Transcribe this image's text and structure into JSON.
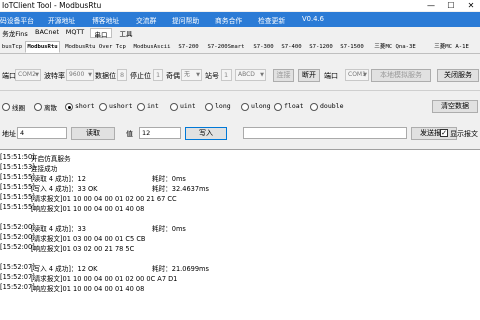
{
  "window": {
    "title": "IoTClient Tool - ModbusRtu",
    "minimize": "—",
    "maximize": "☐",
    "close": "✕"
  },
  "menu": [
    "码设备平台",
    "开源地址",
    "博客地址",
    "交流群",
    "提问帮助",
    "商务合作",
    "检查更新",
    "V0.4.6"
  ],
  "tabs_row1": [
    "务龙Fins",
    "BACnet",
    "MQTT",
    "串口",
    "工具"
  ],
  "tabs_row2": [
    "busTcp",
    "ModbusRtu",
    "ModbusRtu Over Tcp",
    "ModbusAscii",
    "S7-200",
    "S7-200Smart",
    "S7-300",
    "S7-400",
    "S7-1200",
    "S7-1500",
    "三菱MC Qna-3E",
    "三菱MC A-1E"
  ],
  "serial": {
    "port_label": "端口",
    "port_value": "COM2",
    "baud_label": "波特率",
    "baud_value": "9600",
    "databits_label": "数据位",
    "databits_value": "8",
    "stopbits_label": "停止位",
    "stopbits_value": "1",
    "parity_label": "奇偶",
    "parity_value": "无",
    "station_label": "站号",
    "station_value": "1",
    "abcd_value": "ABCD",
    "connect_btn": "连接",
    "disconnect_btn": "断开",
    "sim_port_label": "端口",
    "sim_port_value": "COM1",
    "start_sim_btn": "本地模拟服务",
    "stop_sim_btn": "关闭服务"
  },
  "types": [
    "线圈",
    "离散",
    "short",
    "ushort",
    "int",
    "uint",
    "long",
    "ulong",
    "float",
    "double"
  ],
  "selected_type": "short",
  "clear_btn": "清空数据",
  "rw": {
    "address_label": "地址",
    "address_value": "4",
    "read_btn": "读取",
    "value_label": "值",
    "value_value": "12",
    "write_btn": "写入",
    "raw_value": "",
    "send_btn": "发送报文",
    "show_msg_label": "显示报文",
    "show_msg_checked": "✓"
  },
  "log": [
    {
      "time": "[15:51:50]",
      "msg": "开启仿真服务"
    },
    {
      "time": "[15:51:53]",
      "msg": "连接成功"
    },
    {
      "time": "[15:51:55]",
      "msg": "[读取 4 成功]：12",
      "extra": "耗时：0ms"
    },
    {
      "time": "[15:51:55]",
      "msg": "[写入 4 成功]：33 OK",
      "extra": "耗时：32.4637ms"
    },
    {
      "time": "[15:51:55]",
      "msg": "[请求报文]01 10 00 04 00 01 02 00 21 67 CC"
    },
    {
      "time": "[15:51:55]",
      "msg": "[响应报文]01 10 00 04 00 01 40 08"
    },
    {
      "time": "",
      "msg": ""
    },
    {
      "time": "[15:52:00]",
      "msg": "[读取 4 成功]：33",
      "extra": "耗时：0ms"
    },
    {
      "time": "[15:52:00]",
      "msg": "[请求报文]01 03 00 04 00 01 C5 CB"
    },
    {
      "time": "[15:52:00]",
      "msg": "[响应报文]01 03 02 00 21 78 5C"
    },
    {
      "time": "",
      "msg": ""
    },
    {
      "time": "[15:52:07]",
      "msg": "[写入 4 成功]：12 OK",
      "extra": "耗时：21.0699ms"
    },
    {
      "time": "[15:52:07]",
      "msg": "[请求报文]01 10 00 04 00 01 02 00 0C A7 D1"
    },
    {
      "time": "[15:52:07]",
      "msg": "[响应报文]01 10 00 04 00 01 40 08"
    }
  ],
  "colors": {
    "menubar": "#2b7bd6",
    "tab_bg": "#f0f0f0"
  }
}
